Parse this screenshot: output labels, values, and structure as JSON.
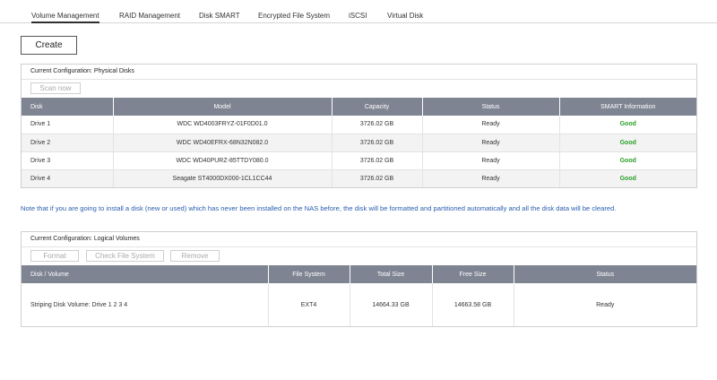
{
  "tabs": [
    {
      "label": "Volume Management"
    },
    {
      "label": "RAID Management"
    },
    {
      "label": "Disk SMART"
    },
    {
      "label": "Encrypted File System"
    },
    {
      "label": "iSCSI"
    },
    {
      "label": "Virtual Disk"
    }
  ],
  "create_label": "Create",
  "physical": {
    "title": "Current Configuration: Physical Disks",
    "scan_label": "Scan now",
    "headers": [
      "Disk",
      "Model",
      "Capacity",
      "Status",
      "SMART Information"
    ],
    "rows": [
      {
        "disk": "Drive 1",
        "model": "WDC WD4003FRYZ-01F0D01.0",
        "capacity": "3726.02 GB",
        "status": "Ready",
        "smart": "Good"
      },
      {
        "disk": "Drive 2",
        "model": "WDC WD40EFRX-68N32N082.0",
        "capacity": "3726.02 GB",
        "status": "Ready",
        "smart": "Good"
      },
      {
        "disk": "Drive 3",
        "model": "WDC WD40PURZ-85TTDY080.0",
        "capacity": "3726.02 GB",
        "status": "Ready",
        "smart": "Good"
      },
      {
        "disk": "Drive 4",
        "model": "Seagate ST4000DX000-1CL1CC44",
        "capacity": "3726.02 GB",
        "status": "Ready",
        "smart": "Good"
      }
    ]
  },
  "note": "Note that if you are going to install a disk (new or used) which has never been installed on the NAS before, the disk will be formatted and partitioned automatically and all the disk data will be cleared.",
  "logical": {
    "title": "Current Configuration: Logical Volumes",
    "format_label": "Format",
    "check_label": "Check File System",
    "remove_label": "Remove",
    "headers": [
      "Disk / Volume",
      "File System",
      "Total Size",
      "Free Size",
      "Status"
    ],
    "rows": [
      {
        "volume": "Striping Disk Volume: Drive 1 2 3 4",
        "fs": "EXT4",
        "total": "14664.33 GB",
        "free": "14663.58 GB",
        "status": "Ready"
      }
    ]
  },
  "colors": {
    "header_bg": "#7f8492",
    "good": "#2aa02a",
    "note": "#2a5db0"
  }
}
